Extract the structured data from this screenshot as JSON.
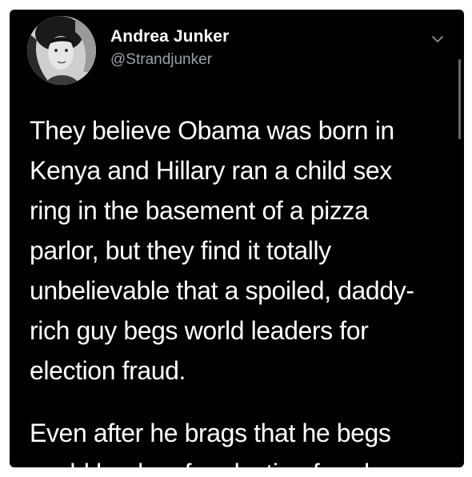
{
  "tweet": {
    "display_name": "Andrea Junker",
    "handle": "@Strandjunker",
    "paragraph_1": [
      "They believe Obama was born in",
      "Kenya and Hillary ran a child sex",
      "ring in the basement of a pizza",
      "parlor, but they find it totally",
      "unbelievable that a spoiled, daddy-",
      "rich guy begs world leaders for",
      "election fraud."
    ],
    "paragraph_2": [
      "Even after he brags that he begs",
      "world leaders for election fraud."
    ],
    "icons": {
      "avatar": "profile-photo",
      "menu": "chevron-down-icon"
    }
  },
  "colors": {
    "background": "#000000",
    "text": "#ffffff",
    "secondary_text": "#9aa0a6",
    "page": "#ffffff"
  }
}
